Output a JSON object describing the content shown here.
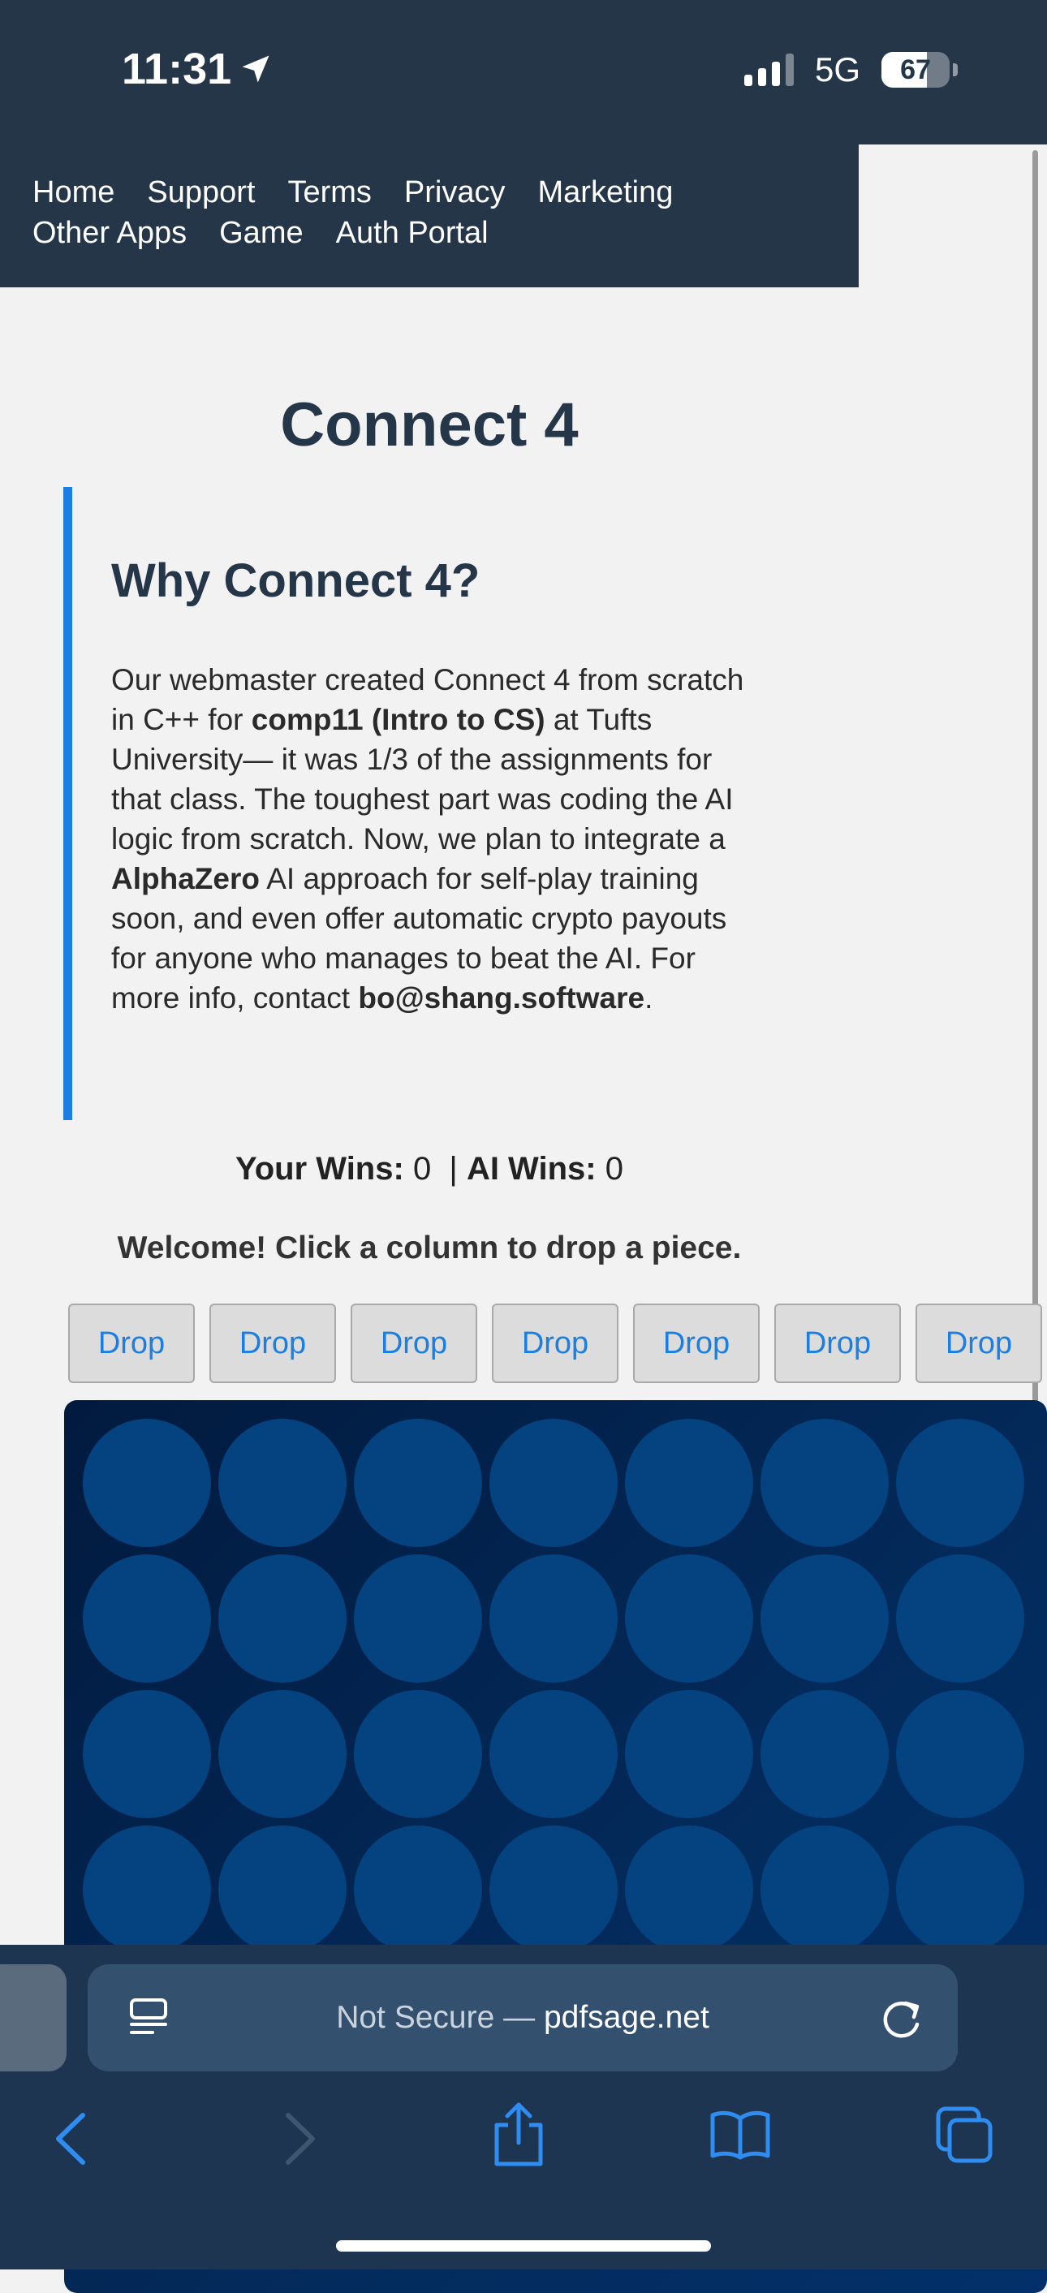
{
  "status_bar": {
    "time": "11:31",
    "network": "5G",
    "battery_percent": "67",
    "battery_level": 0.67
  },
  "nav": {
    "links": [
      "Home",
      "Support",
      "Terms",
      "Privacy",
      "Marketing",
      "Other Apps",
      "Game",
      "Auth Portal"
    ]
  },
  "page": {
    "title": "Connect 4"
  },
  "info": {
    "heading": "Why Connect 4?",
    "text_1": "Our webmaster created Connect 4 from scratch in C++ for ",
    "bold_1": "comp11 (Intro to CS)",
    "text_2": " at Tufts University— it was 1/3 of the assignments for that class. The toughest part was coding the AI logic from scratch. Now, we plan to integrate a ",
    "bold_2": "AlphaZero",
    "text_3": " AI approach for self-play training soon, and even offer automatic crypto payouts for anyone who manages to beat the AI. For more info, contact ",
    "bold_3": "bo@shang.software",
    "text_4": "."
  },
  "score": {
    "your_label": "Your Wins:",
    "your_value": "0",
    "separator": "|",
    "ai_label": "AI Wins:",
    "ai_value": "0"
  },
  "game": {
    "message": "Welcome! Click a column to drop a piece.",
    "drop_label": "Drop",
    "columns": 7,
    "rows": 6,
    "colors": {
      "board": "#032b5c",
      "empty_cell": "#04437f"
    }
  },
  "safari": {
    "url_prefix": "Not Secure — ",
    "url_domain": "pdfsage.net",
    "icons": [
      "reader-icon",
      "reload-icon",
      "back-icon",
      "forward-icon",
      "share-icon",
      "bookmarks-icon",
      "tabs-icon"
    ]
  },
  "colors": {
    "nav_bg": "#253649",
    "accent": "#1a7fe0",
    "title": "#253649"
  }
}
